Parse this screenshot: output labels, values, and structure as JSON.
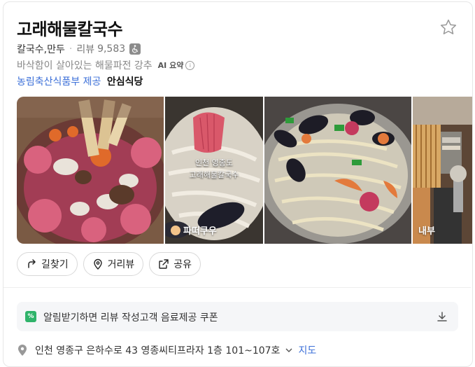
{
  "place": {
    "name": "고래해물칼국수",
    "category": "칼국수,만두",
    "review_label": "리뷰",
    "review_count": "9,583",
    "summary": "바삭함이 살아있는 해물파전 강추",
    "ai_badge": "AI 요약",
    "certifier": "농림축산식품부 제공",
    "certification": "안심식당"
  },
  "photos": {
    "caption_line1": "인천 영종도",
    "caption_line2": "고래해물칼국수",
    "label_2": "파떠쿠우",
    "label_4": "내부"
  },
  "actions": {
    "directions": "길찾기",
    "street_view": "거리뷰",
    "share": "공유"
  },
  "coupon": {
    "text": "알림받기하면 리뷰 작성고객 음료제공 쿠폰",
    "icon": "%"
  },
  "address": {
    "text": "인천 영종구 은하수로 43 영종씨티프라자 1층 101~107호",
    "map_link": "지도"
  },
  "colors": {
    "link": "#3b6fd8",
    "coupon_icon": "#2fb36a"
  }
}
